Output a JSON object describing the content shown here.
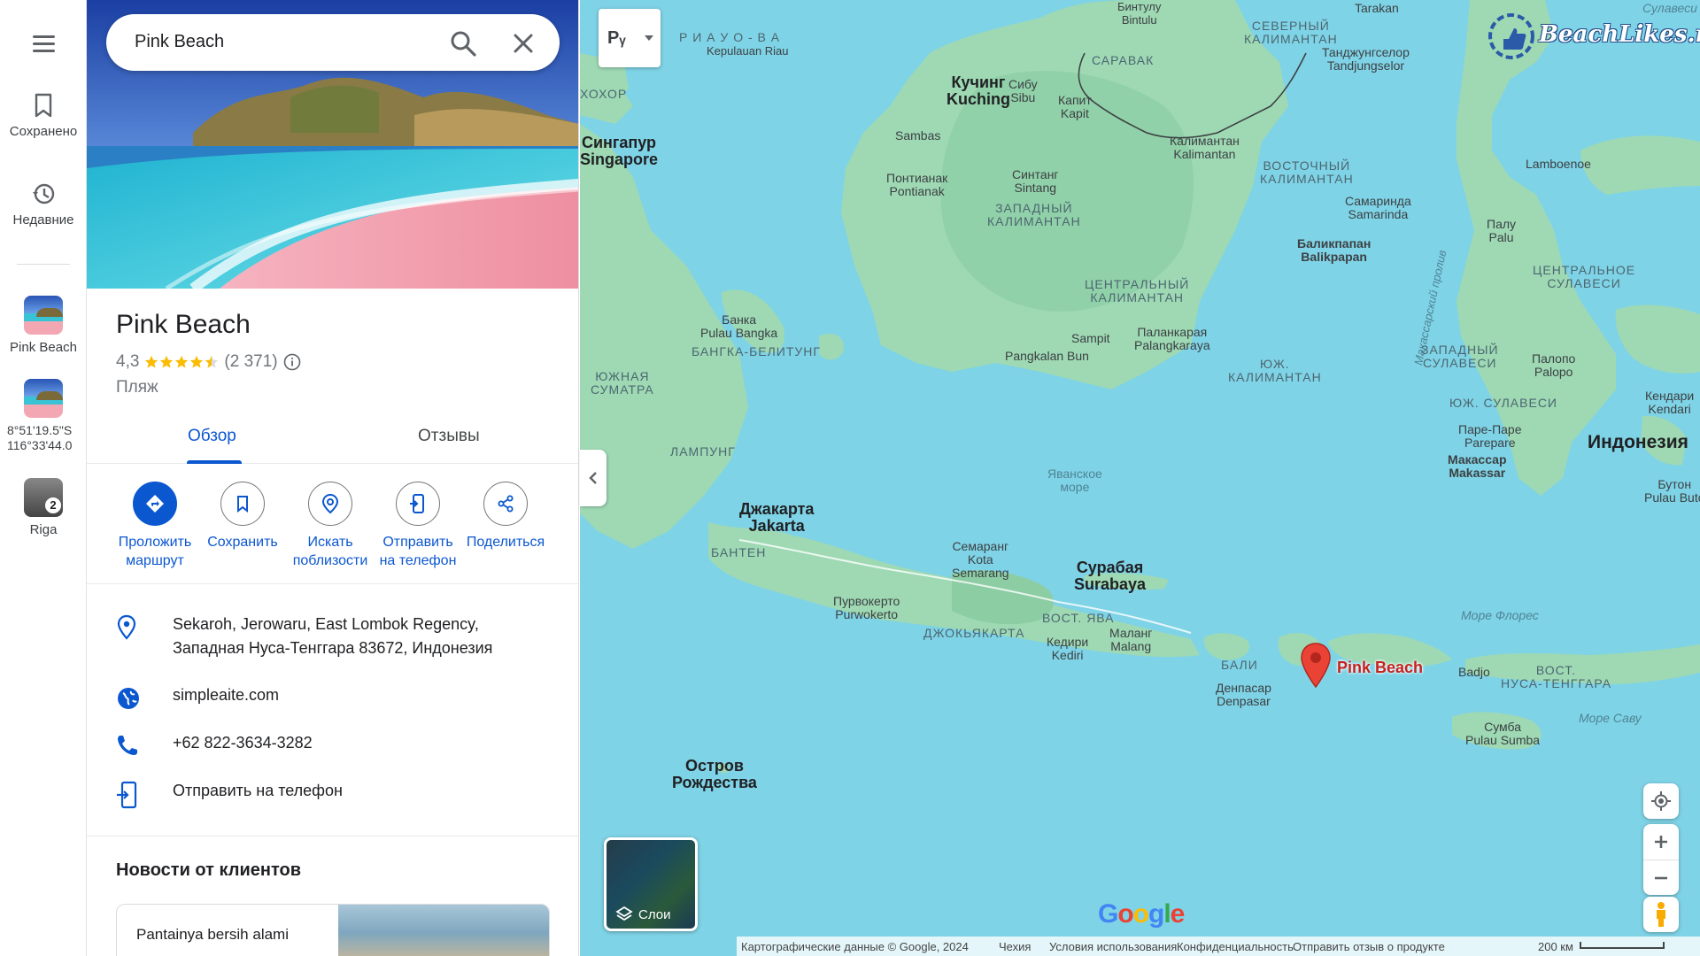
{
  "rail": {
    "saved_label": "Сохранено",
    "recent_label": "Недавние",
    "items": [
      {
        "label": "Pink Beach"
      },
      {
        "label": "8°51'19.5\"S 116°33'44.0"
      },
      {
        "label": "Riga",
        "badge": "2"
      }
    ]
  },
  "search": {
    "query": "Pink Beach"
  },
  "place": {
    "title": "Pink Beach",
    "rating": "4,3",
    "stars": 4.3,
    "reviews": "(2 371)",
    "category": "Пляж"
  },
  "tabs": {
    "overview": "Обзор",
    "reviews": "Отзывы"
  },
  "actions": [
    {
      "line1": "Проложить",
      "line2": "маршрут"
    },
    {
      "line1": "Сохранить",
      "line2": ""
    },
    {
      "line1": "Искать",
      "line2": "поблизости"
    },
    {
      "line1": "Отправить",
      "line2": "на телефон"
    },
    {
      "line1": "Поделиться",
      "line2": ""
    }
  ],
  "info": {
    "address_line1": "Sekaroh, Jerowaru, East Lombok Regency,",
    "address_line2": "Западная Нуса-Тенггара 83672, Индонезия",
    "website": "simpleaite.com",
    "phone": "+62 822-3634-3282",
    "send_to_phone": "Отправить на телефон"
  },
  "news": {
    "title": "Новости от клиентов",
    "card_text": "Pantainya bersih alami"
  },
  "map": {
    "lang": "Рᵧ",
    "watermark": "BeachLikes.ru",
    "layers_label": "Слои",
    "pin_label": "Pink Beach",
    "google_logo": "Google",
    "labels": {
      "riau": "Р И А У   О - В А",
      "riau2": "Kepulauan Riau",
      "bintulu": "Бинтулу\nBintulu",
      "severny": "СЕВЕРНЫЙ\nКАЛИМАНТАН",
      "tarakan": "Tarakan",
      "sulavesi_sea": "Сулавеси",
      "tanjung": "Танджунгселор\nTandjungselor",
      "sarawak": "САРАВАК",
      "kuching": "Кучинг\nKuching",
      "sibu": "Сибу\nSibu",
      "kapit": "Капит\nKapit",
      "johor": "ХОХОР",
      "singapore": "Сингапур\nSingapore",
      "sambas": "Sambas",
      "kalimantan": "Калимантан\nKalimantan",
      "pontianak": "Понтианак\nPontianak",
      "sintang": "Синтанг\nSintang",
      "zap_kal": "ЗАПАДНЫЙ\nКАЛИМАНТАН",
      "vost_kal": "ВОСТОЧНЫЙ\nКАЛИМАНТАН",
      "samarinda": "Самаринда\nSamarinda",
      "lamboenoe": "Lamboenoe",
      "balikpapan": "Баликпапан\nBalikpapan",
      "palu": "Палу\nPalu",
      "centr_sul": "ЦЕНТРАЛЬНОЕ\nСУЛАВЕСИ",
      "makassar_strait": "Макассарский пролив",
      "centr_kal": "ЦЕНТРАЛЬНЫЙ\nКАЛИМАНТАН",
      "bangka": "Банка\nPulau Bangka",
      "bangka_bel": "БАНГКА-БЕЛИТУНГ",
      "sampit": "Sampit",
      "palangkaraya": "Паланкарая\nPalangkaraya",
      "pangkalan": "Pangkalan Bun",
      "zap_sul": "ЗАПАДНЫЙ\nСУЛАВЕСИ",
      "palopo": "Палопо\nPalopo",
      "yuzh_sum": "ЮЖНАЯ\nСУМАТРА",
      "yuzh_kal": "ЮЖ.\nКАЛИМАНТАН",
      "kendari": "Кендари\nKendari",
      "yuzh_sul": "ЮЖ. СУЛАВЕСИ",
      "parepare": "Паре-Паре\nParepare",
      "indonesia": "Индонезия",
      "makassar": "Макассар\nMakassar",
      "lampung": "ЛАМПУНГ",
      "java_sea": "Яванское\nморе",
      "buton": "Бутон\nPulau Buto",
      "jakarta": "Джакарта\nJakarta",
      "banten": "БАНТЕН",
      "semarang": "Семаранг\nKota\nSemarang",
      "surabaya": "Сурабая\nSurabaya",
      "flores_sea": "Море Флорес",
      "purwokerto": "Пурвокерто\nPurwokerto",
      "jogja": "ДЖОКЬЯКАРТА",
      "vost_java": "ВОСТ. ЯВА",
      "kediri": "Кедири\nKediri",
      "malang": "Маланг\nMalang",
      "bali": "БАЛИ",
      "denpasar": "Денпасар\nDenpasar",
      "badjo": "Badjo",
      "vost_nusa": "ВОСТ.\nНУСА-ТЕНГГАРА",
      "savu_sea": "Море Саву",
      "sumba": "Сумба\nPulau Sumba",
      "christmas": "Остров\nРождества"
    },
    "footer": {
      "data": "Картографические данные © Google, 2024",
      "country": "Чехия",
      "terms": "Условия использования",
      "privacy": "Конфиденциальность",
      "feedback": "Отправить отзыв о продукте",
      "scale": "200 км"
    }
  }
}
